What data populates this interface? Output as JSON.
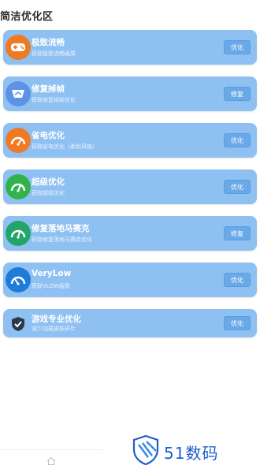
{
  "section": {
    "title": "简洁优化区"
  },
  "cards": [
    {
      "title": "极致流畅",
      "subtitle": "获取极致流畅画质",
      "button": "优化",
      "icon": "gamepad-icon",
      "icon_bg": "#ef7a24"
    },
    {
      "title": "修复掉帧",
      "subtitle": "获取修复掉帧优化",
      "button": "修复",
      "icon": "display-icon",
      "icon_bg": "#5c93e6"
    },
    {
      "title": "省电优化",
      "subtitle": "获取省电优化（柔和风格）",
      "button": "优化",
      "icon": "speedometer-icon",
      "icon_bg": "#ef7a24"
    },
    {
      "title": "超级优化",
      "subtitle": "获取超级优化",
      "button": "优化",
      "icon": "speedometer-icon",
      "icon_bg": "#31b34b"
    },
    {
      "title": "修复落地马赛克",
      "subtitle": "获取修复落地马赛克优化",
      "button": "修复",
      "icon": "speedometer-icon",
      "icon_bg": "#23a56a"
    },
    {
      "title": "VeryLow",
      "subtitle": "获取VLOW画质",
      "button": "优化",
      "icon": "speedometer-icon",
      "icon_bg": "#1f7ad8"
    },
    {
      "title": "游戏专业优化",
      "subtitle": "减少加载皮肤碎片",
      "button": "优化",
      "icon": "shield-check-icon",
      "icon_bg": "#2b3a4a"
    }
  ],
  "nav": {
    "home_icon": "home-icon"
  },
  "watermark": {
    "text": "51数码"
  },
  "colors": {
    "card_bg": "#8fc0f2",
    "button_bg": "#6aa9e8",
    "watermark": "#1f5fc8"
  }
}
